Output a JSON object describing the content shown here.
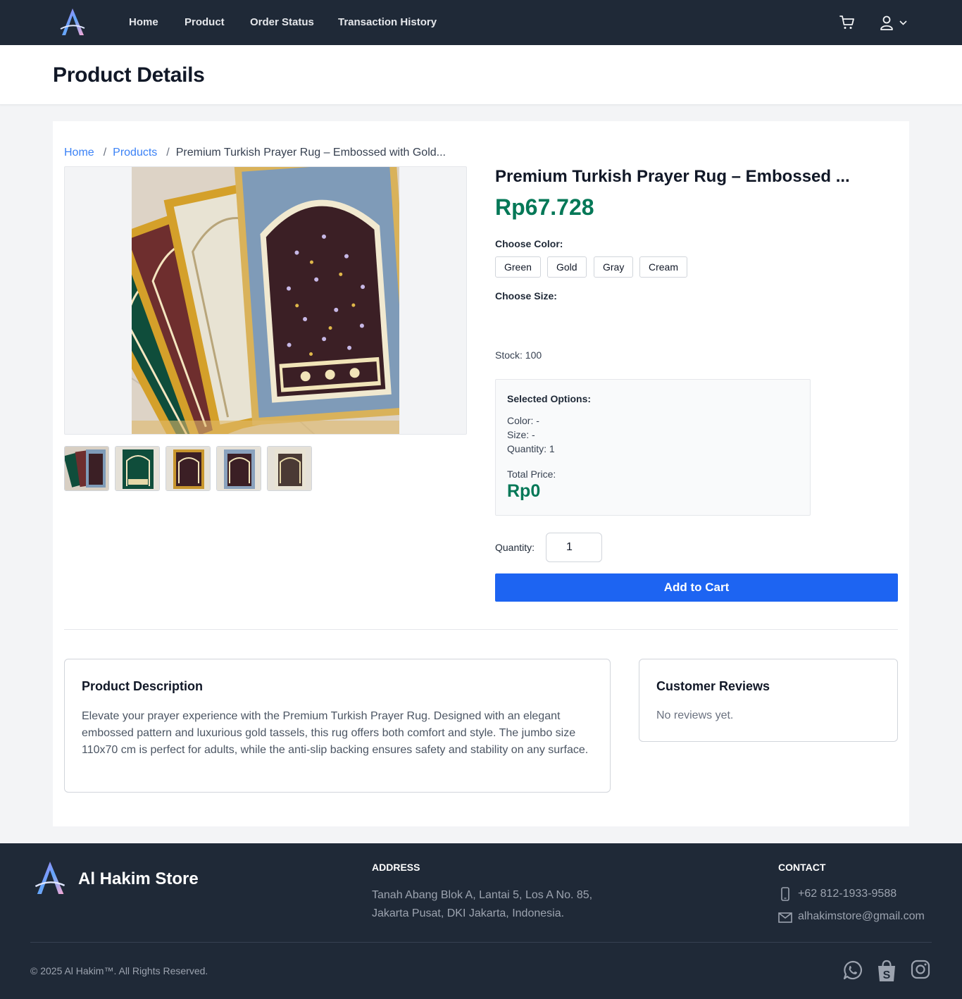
{
  "nav": {
    "brand_logo": "logo-icon",
    "links": [
      "Home",
      "Product",
      "Order Status",
      "Transaction History"
    ],
    "cart_icon": "cart-icon",
    "user_icon": "user-icon"
  },
  "header": {
    "title": "Product Details"
  },
  "breadcrumb": {
    "home": "Home",
    "products": "Products",
    "sep": "/",
    "current": "Premium Turkish Prayer Rug – Embossed with Gold..."
  },
  "product": {
    "title": "Premium Turkish Prayer Rug – Embossed ...",
    "price": "Rp67.728",
    "color_label": "Choose Color:",
    "colors": [
      "Green",
      "Gold",
      "Gray",
      "Cream"
    ],
    "size_label": "Choose Size:",
    "stock": "Stock: 100",
    "thumbnail_count": 5
  },
  "summary": {
    "title": "Selected Options:",
    "color": "Color: -",
    "size": "Size: -",
    "quantity": "Quantity: 1",
    "total_label": "Total Price:",
    "total": "Rp0"
  },
  "purchase": {
    "quantity_label": "Quantity:",
    "quantity_value": "1",
    "add_to_cart": "Add to Cart"
  },
  "description": {
    "title": "Product Description",
    "text": "Elevate your prayer experience with the Premium Turkish Prayer Rug. Designed with an elegant embossed pattern and luxurious gold tassels, this rug offers both comfort and style. The jumbo size 110x70 cm is perfect for adults, while the anti-slip backing ensures safety and stability on any surface."
  },
  "reviews": {
    "title": "Customer Reviews",
    "empty": "No reviews yet."
  },
  "footer": {
    "brand": "Al Hakim Store",
    "address_heading": "ADDRESS",
    "address": "Tanah Abang Blok A, Lantai 5, Los A No. 85, Jakarta Pusat, DKI Jakarta, Indonesia.",
    "contact_heading": "CONTACT",
    "phone": "+62 812-1933-9588",
    "email": "alhakimstore@gmail.com",
    "copyright": "© 2025 Al Hakim™. All Rights Reserved.",
    "social": [
      "whatsapp-icon",
      "shopee-icon",
      "instagram-icon"
    ]
  },
  "colors": {
    "nav_bg": "#1f2937",
    "price_green": "#047857",
    "link_blue": "#3b82f6",
    "button_blue": "#1d64f2"
  }
}
